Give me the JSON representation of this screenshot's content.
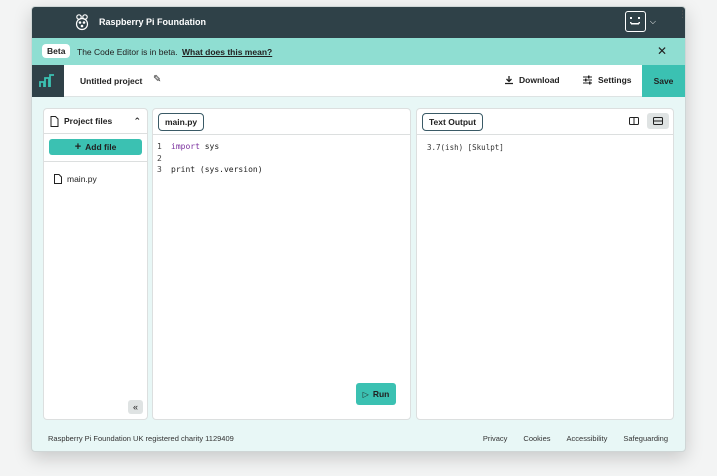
{
  "topbar": {
    "brand": "Raspberry Pi Foundation"
  },
  "banner": {
    "badge": "Beta",
    "text": "The Code Editor is in beta.",
    "link": "What does this mean?"
  },
  "project": {
    "name": "Untitled project",
    "download_label": "Download",
    "settings_label": "Settings",
    "save_label": "Save"
  },
  "files": {
    "title": "Project files",
    "add_file_label": "Add file",
    "items": [
      {
        "name": "main.py"
      }
    ]
  },
  "editor": {
    "tab": "main.py",
    "lines": [
      {
        "num": "1",
        "keyword": "import",
        "rest": " sys"
      },
      {
        "num": "2",
        "keyword": "",
        "rest": ""
      },
      {
        "num": "3",
        "keyword": "",
        "rest": "print (sys.version)"
      }
    ],
    "run_label": "Run"
  },
  "output": {
    "tab": "Text Output",
    "text": "3.7(ish) [Skulpt]"
  },
  "footer": {
    "charity": "Raspberry Pi Foundation UK registered charity 1129409",
    "links": [
      "Privacy",
      "Cookies",
      "Accessibility",
      "Safeguarding"
    ]
  },
  "colors": {
    "topbar": "#2f4148",
    "banner": "#8fded2",
    "accent": "#3bc1b2",
    "background": "#e8f7f6"
  }
}
